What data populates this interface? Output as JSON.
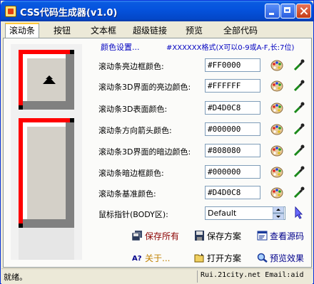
{
  "window": {
    "title": "CSS代码生成器(v1.0)"
  },
  "tabs": [
    {
      "label": "滚动条",
      "active": true
    },
    {
      "label": "按钮"
    },
    {
      "label": "文本框"
    },
    {
      "label": "超级链接"
    },
    {
      "label": "预览"
    },
    {
      "label": "全部代码"
    }
  ],
  "form": {
    "header": "颜色设置...",
    "format_hint": "#XXXXXX格式(X可以0-9或A-F,长:7位)",
    "fields": [
      {
        "label": "滚动条亮边框颜色:",
        "value": "#FF0000"
      },
      {
        "label": "滚动条3D界面的亮边颜色:",
        "value": "#FFFFFF"
      },
      {
        "label": "滚动条3D表面颜色:",
        "value": "#D4D0C8"
      },
      {
        "label": "滚动条方向箭头颜色:",
        "value": "#000000"
      },
      {
        "label": "滚动条3D界面的暗边颜色:",
        "value": "#808080"
      },
      {
        "label": "滚动条暗边框颜色:",
        "value": "#000000"
      },
      {
        "label": "滚动条基准颜色:",
        "value": "#D4D0C8"
      }
    ],
    "cursor": {
      "label": "鼠标指针(BODY区):",
      "value": "Default"
    }
  },
  "actions": {
    "save_all": "保存所有",
    "save_scheme": "保存方案",
    "view_source": "查看源码",
    "about": "关于...",
    "open_scheme": "打开方案",
    "preview_effect": "预览效果"
  },
  "status": {
    "left": "就绪。",
    "right": "Rui.21city.net Email:aid"
  },
  "colors": {
    "highlight": "#FF0000",
    "3dlight": "#FFFFFF",
    "face": "#D4D0C8",
    "arrow": "#000000",
    "shadow": "#808080",
    "darkshadow": "#000000",
    "track": "#D4D0C8"
  }
}
